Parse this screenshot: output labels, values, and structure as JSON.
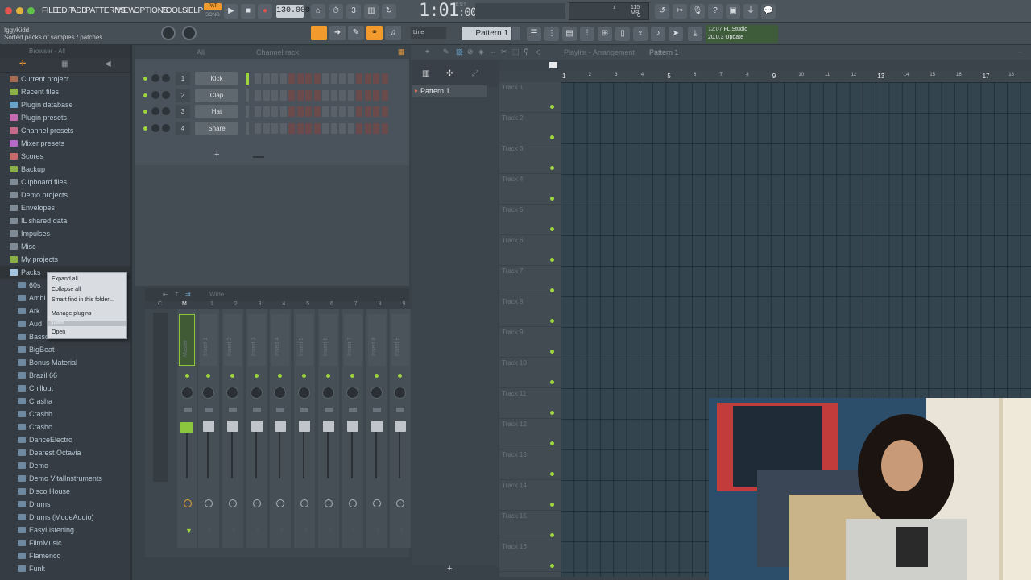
{
  "menu": [
    "FILE",
    "EDIT",
    "ADD",
    "PATTERNS",
    "VIEW",
    "OPTIONS",
    "TOOLS",
    "HELP"
  ],
  "transport": {
    "pat_label": "PAT",
    "song_label": "SONG",
    "tempo": "130.000",
    "time": "1:01",
    "time_sub": ":00",
    "time_unit": "B:S:T",
    "cpu": "115 MB",
    "cpu_small": "1",
    "cpu_zero": "0"
  },
  "hint": {
    "user": "IggyKidd",
    "text": "Sorted packs of samples / patches"
  },
  "toolbar2": {
    "snap": "Line",
    "pattern": "Pattern 1",
    "news_time": "12:07",
    "news_title": "FL Studio",
    "news_sub": "20.0.3 Update"
  },
  "browser": {
    "header": "Browser - All",
    "items": [
      {
        "label": "Current project",
        "color": "#a46a52"
      },
      {
        "label": "Recent files",
        "color": "#8bb04a"
      },
      {
        "label": "Plugin database",
        "color": "#6aa3c8"
      },
      {
        "label": "Plugin presets",
        "color": "#c56bb1"
      },
      {
        "label": "Channel presets",
        "color": "#c56b8a"
      },
      {
        "label": "Mixer presets",
        "color": "#b56bc5"
      },
      {
        "label": "Scores",
        "color": "#c56b6b"
      },
      {
        "label": "Backup",
        "color": "#8bb04a"
      },
      {
        "label": "Clipboard files",
        "color": "#7f8b94"
      },
      {
        "label": "Demo projects",
        "color": "#7f8b94"
      },
      {
        "label": "Envelopes",
        "color": "#7f8b94"
      },
      {
        "label": "IL shared data",
        "color": "#7f8b94"
      },
      {
        "label": "Impulses",
        "color": "#7f8b94"
      },
      {
        "label": "Misc",
        "color": "#7f8b94"
      },
      {
        "label": "My projects",
        "color": "#8bb04a"
      },
      {
        "label": "Packs",
        "color": "#a5c6de"
      }
    ],
    "subitems": [
      "60s",
      "Ambi",
      "Ark",
      "Aud",
      "Bassdrum",
      "BigBeat",
      "Bonus Material",
      "Brazil 66",
      "Chillout",
      "Crasha",
      "Crashb",
      "Crashc",
      "DanceElectro",
      "Dearest Octavia",
      "Demo",
      "Demo VitalInstruments",
      "Disco House",
      "Drums",
      "Drums (ModeAudio)",
      "EasyListening",
      "FilmMusic",
      "Flamenco",
      "Funk"
    ]
  },
  "context_menu": [
    "Expand all",
    "Collapse all",
    "Smart find in this folder...",
    "Manage plugins",
    "System",
    "Open"
  ],
  "channel_rack": {
    "title": "Channel rack",
    "filter": "All",
    "channels": [
      {
        "num": "1",
        "name": "Kick"
      },
      {
        "num": "2",
        "name": "Clap"
      },
      {
        "num": "3",
        "name": "Hat"
      },
      {
        "num": "4",
        "name": "Snare"
      }
    ],
    "add": "+"
  },
  "mixer": {
    "title": "Wide",
    "strips": [
      "Master",
      "Insert 1",
      "Insert 2",
      "Insert 3",
      "Insert 4",
      "Insert 5",
      "Insert 6",
      "Insert 7",
      "Insert 8",
      "Insert 9"
    ],
    "strip_numbers": [
      "C",
      "M",
      "1",
      "2",
      "3",
      "4",
      "5",
      "6",
      "7",
      "8",
      "9"
    ]
  },
  "playlist": {
    "breadcrumb": "Playlist - Arrangement",
    "pattern": "Pattern 1",
    "pattern_list": [
      "Pattern 1"
    ],
    "ruler": [
      "1",
      "2",
      "3",
      "4",
      "5",
      "6",
      "7",
      "8",
      "9",
      "10",
      "11",
      "12",
      "13",
      "14",
      "15",
      "16",
      "17",
      "18"
    ],
    "tracks": [
      "Track 1",
      "Track 2",
      "Track 3",
      "Track 4",
      "Track 5",
      "Track 6",
      "Track 7",
      "Track 8",
      "Track 9",
      "Track 10",
      "Track 11",
      "Track 12",
      "Track 13",
      "Track 14",
      "Track 15",
      "Track 16"
    ],
    "add": "+"
  }
}
